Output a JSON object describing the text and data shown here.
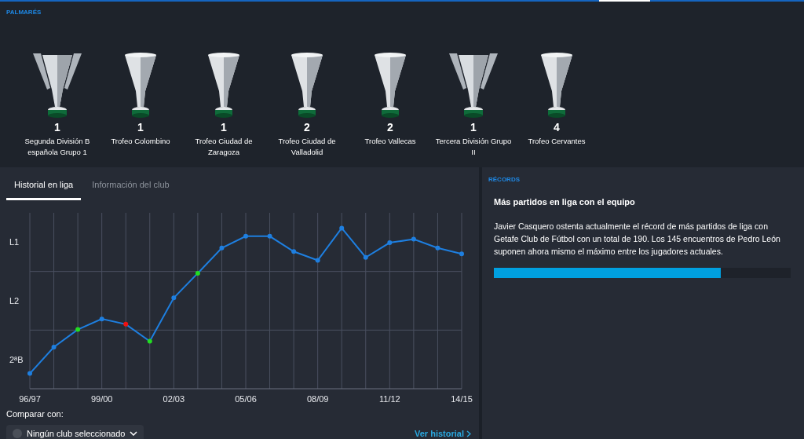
{
  "palmares": {
    "title": "PALMARÉS",
    "trophies": [
      {
        "kind": "handled",
        "count": "1",
        "name": "Segunda División B española Grupo 1"
      },
      {
        "kind": "cup",
        "count": "1",
        "name": "Trofeo Colombino"
      },
      {
        "kind": "cup",
        "count": "1",
        "name": "Trofeo Ciudad de Zaragoza"
      },
      {
        "kind": "cup",
        "count": "2",
        "name": "Trofeo Ciudad de Valladolid"
      },
      {
        "kind": "cup",
        "count": "2",
        "name": "Trofeo Vallecas"
      },
      {
        "kind": "handled",
        "count": "1",
        "name": "Tercera División Grupo II"
      },
      {
        "kind": "cup",
        "count": "4",
        "name": "Trofeo Cervantes"
      }
    ]
  },
  "tabs": [
    {
      "label": "Historial en liga",
      "selected": true
    },
    {
      "label": "Información del club",
      "selected": false
    }
  ],
  "history": {
    "season_labels": [
      "96/97",
      "99/00",
      "02/03",
      "05/06",
      "08/09",
      "11/12",
      "14/15"
    ],
    "level_labels": [
      "L1",
      "L2",
      "2ªB"
    ],
    "points": [
      {
        "color": "#1e7fe0"
      },
      {
        "color": "#1e7fe0"
      },
      {
        "color": "#22dd22"
      },
      {
        "color": "#1e7fe0"
      },
      {
        "color": "#ee1111"
      },
      {
        "color": "#22dd22"
      },
      {
        "color": "#1e7fe0"
      },
      {
        "color": "#22dd22"
      },
      {
        "color": "#1e7fe0"
      },
      {
        "color": "#1e7fe0"
      },
      {
        "color": "#1e7fe0"
      },
      {
        "color": "#1e7fe0"
      },
      {
        "color": "#1e7fe0"
      },
      {
        "color": "#1e7fe0"
      },
      {
        "color": "#1e7fe0"
      },
      {
        "color": "#1e7fe0"
      },
      {
        "color": "#1e7fe0"
      },
      {
        "color": "#1e7fe0"
      },
      {
        "color": "#1e7fe0"
      }
    ],
    "compare_label": "Comparar con:",
    "compare_select": "Ningún club seleccionado",
    "history_link": "Ver historial"
  },
  "records": {
    "title": "RÉCORDS",
    "heading": "Más partidos en liga con el equipo",
    "text": "Javier Casquero ostenta actualmente el récord de más partidos de liga con Getafe Club de Fútbol con un total de 190. Los 145 encuentros de Pedro León suponen ahora mismo el máximo entre los jugadores actuales.",
    "level": 0.765
  }
}
